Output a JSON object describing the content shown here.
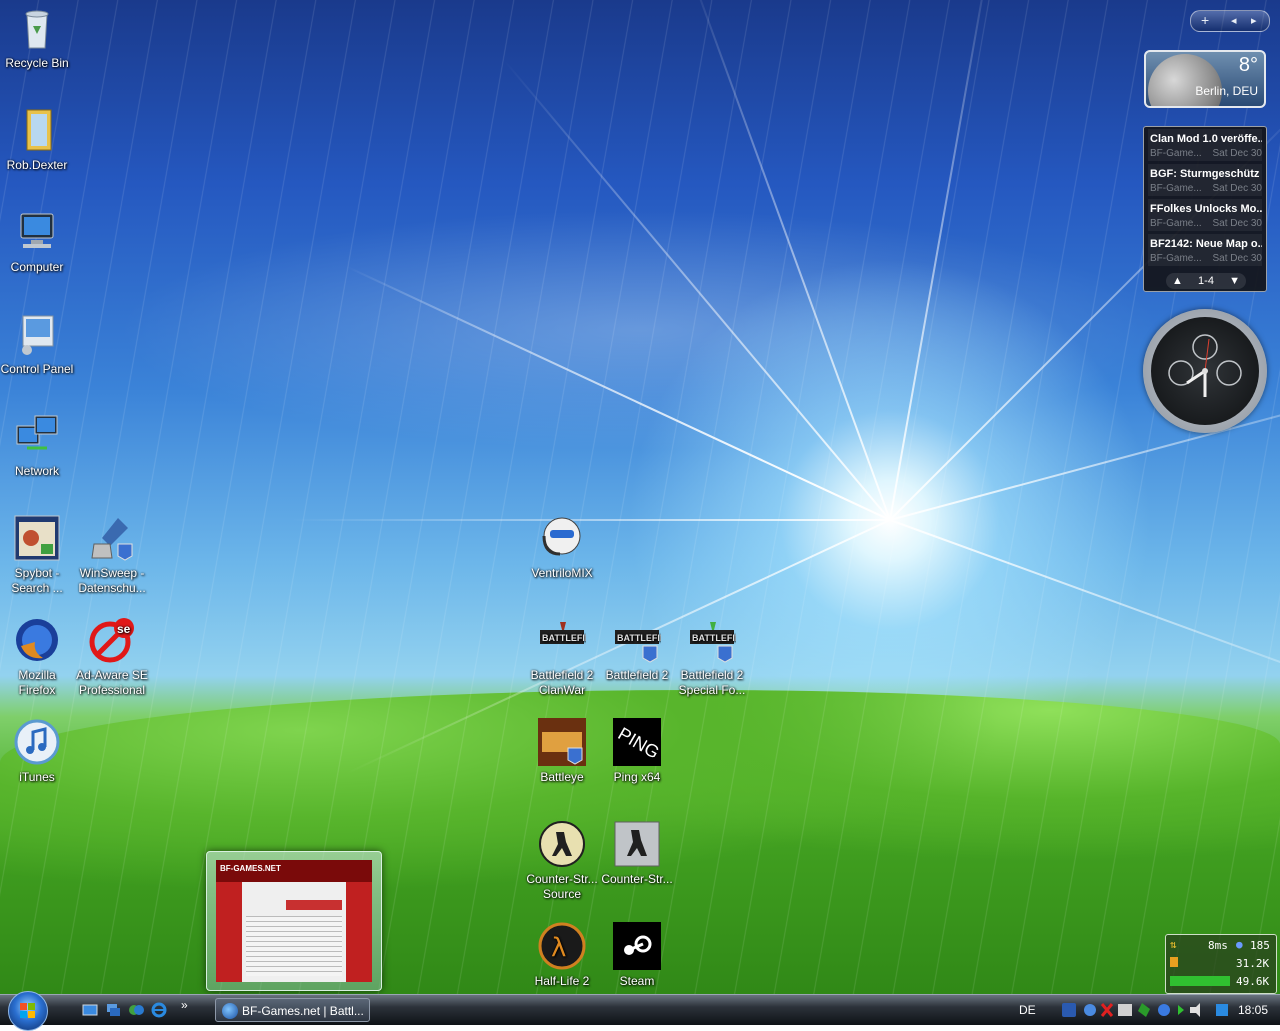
{
  "desktop_icons": [
    {
      "id": "recycle",
      "label": "Recycle Bin"
    },
    {
      "id": "robdexter",
      "label": "Rob.Dexter"
    },
    {
      "id": "computer",
      "label": "Computer"
    },
    {
      "id": "controlpanel",
      "label": "Control Panel"
    },
    {
      "id": "network",
      "label": "Network"
    },
    {
      "id": "spybot",
      "label": "Spybot - Search ..."
    },
    {
      "id": "winsweep",
      "label": "WinSweep - Datenschu..."
    },
    {
      "id": "firefox",
      "label": "Mozilla Firefox"
    },
    {
      "id": "adaware",
      "label": "Ad-Aware SE Professional"
    },
    {
      "id": "itunes",
      "label": "iTunes"
    },
    {
      "id": "ventrilo",
      "label": "VentriloMIX"
    },
    {
      "id": "bf2clanwar",
      "label": "Battlefield 2 ClanWar"
    },
    {
      "id": "bf2",
      "label": "Battlefield 2"
    },
    {
      "id": "bf2sf",
      "label": "Battlefield 2 Special Fo..."
    },
    {
      "id": "battleye",
      "label": "Battleye"
    },
    {
      "id": "ping",
      "label": "Ping x64"
    },
    {
      "id": "css",
      "label": "Counter-Str... Source"
    },
    {
      "id": "cs",
      "label": "Counter-Str..."
    },
    {
      "id": "hl2",
      "label": "Half-Life 2"
    },
    {
      "id": "steam",
      "label": "Steam"
    }
  ],
  "gadget_toolbar": {
    "add": "+",
    "prev": "◂",
    "next": "▸"
  },
  "weather": {
    "temperature": "8°",
    "city": "Berlin, DEU"
  },
  "feeds": {
    "items": [
      {
        "title": "Clan Mod 1.0 veröffe...",
        "source": "BF-Game...",
        "date": "Sat Dec 30"
      },
      {
        "title": "BGF: Sturmgeschütz ...",
        "source": "BF-Game...",
        "date": "Sat Dec 30"
      },
      {
        "title": "FFolkes Unlocks Mo...",
        "source": "BF-Game...",
        "date": "Sat Dec 30"
      },
      {
        "title": "BF2142: Neue Map o...",
        "source": "BF-Game...",
        "date": "Sat Dec 30"
      }
    ],
    "range": "1-4"
  },
  "netmeter": {
    "ping": "8ms",
    "count": "185",
    "up": "31.2K",
    "down": "49.6K"
  },
  "taskbar": {
    "task_label": "BF-Games.net | Battl...",
    "chevron": "»",
    "language": "DE",
    "time": "18:05"
  },
  "thumbnail": {
    "banner": "BF-GAMES.NET"
  }
}
